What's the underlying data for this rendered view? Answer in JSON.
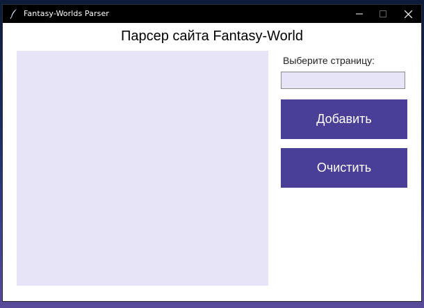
{
  "window": {
    "title": "Fantasy-Worlds Parser",
    "app_icon": "feather-quill-icon",
    "controls": [
      "minimize-icon",
      "maximize-icon",
      "close-icon"
    ]
  },
  "main": {
    "heading": "Парсер сайта Fantasy-World",
    "list_items": [],
    "page_label": "Выберите страницу:",
    "page_input_value": "",
    "add_button": "Добавить",
    "clear_button": "Очистить"
  },
  "colors": {
    "titlebar": "#000000",
    "panel_background": "#e6e4f6",
    "button": "#4a3f96",
    "button_text": "#ffffff"
  }
}
